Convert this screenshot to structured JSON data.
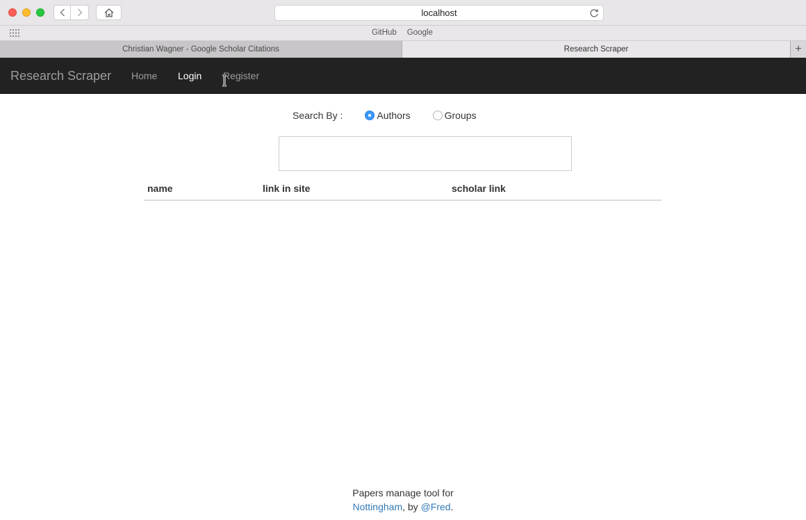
{
  "browser": {
    "url": "localhost",
    "bookmarks": [
      "GitHub",
      "Google"
    ],
    "tabs": [
      {
        "title": "Christian Wagner - Google Scholar Citations",
        "active": false
      },
      {
        "title": "Research Scraper",
        "active": true
      }
    ],
    "new_tab_symbol": "+"
  },
  "navbar": {
    "brand": "Research Scraper",
    "items": [
      "Home",
      "Login",
      "Register"
    ],
    "active_item": "Login"
  },
  "search": {
    "label": "Search By :",
    "options": [
      "Authors",
      "Groups"
    ],
    "selected": "Authors",
    "value": "",
    "placeholder": ""
  },
  "table": {
    "columns": [
      "name",
      "link in site",
      "scholar link"
    ],
    "rows": []
  },
  "footer": {
    "line1": "Papers manage tool for",
    "link1": "Nottingham",
    "sep": ", by ",
    "link2": "@Fred",
    "end": "."
  },
  "colors": {
    "navbar_bg": "#222222",
    "navbar_text": "#9d9d9d",
    "active_text": "#ffffff",
    "radio_checked": "#3b99fc",
    "link": "#337ab7"
  }
}
